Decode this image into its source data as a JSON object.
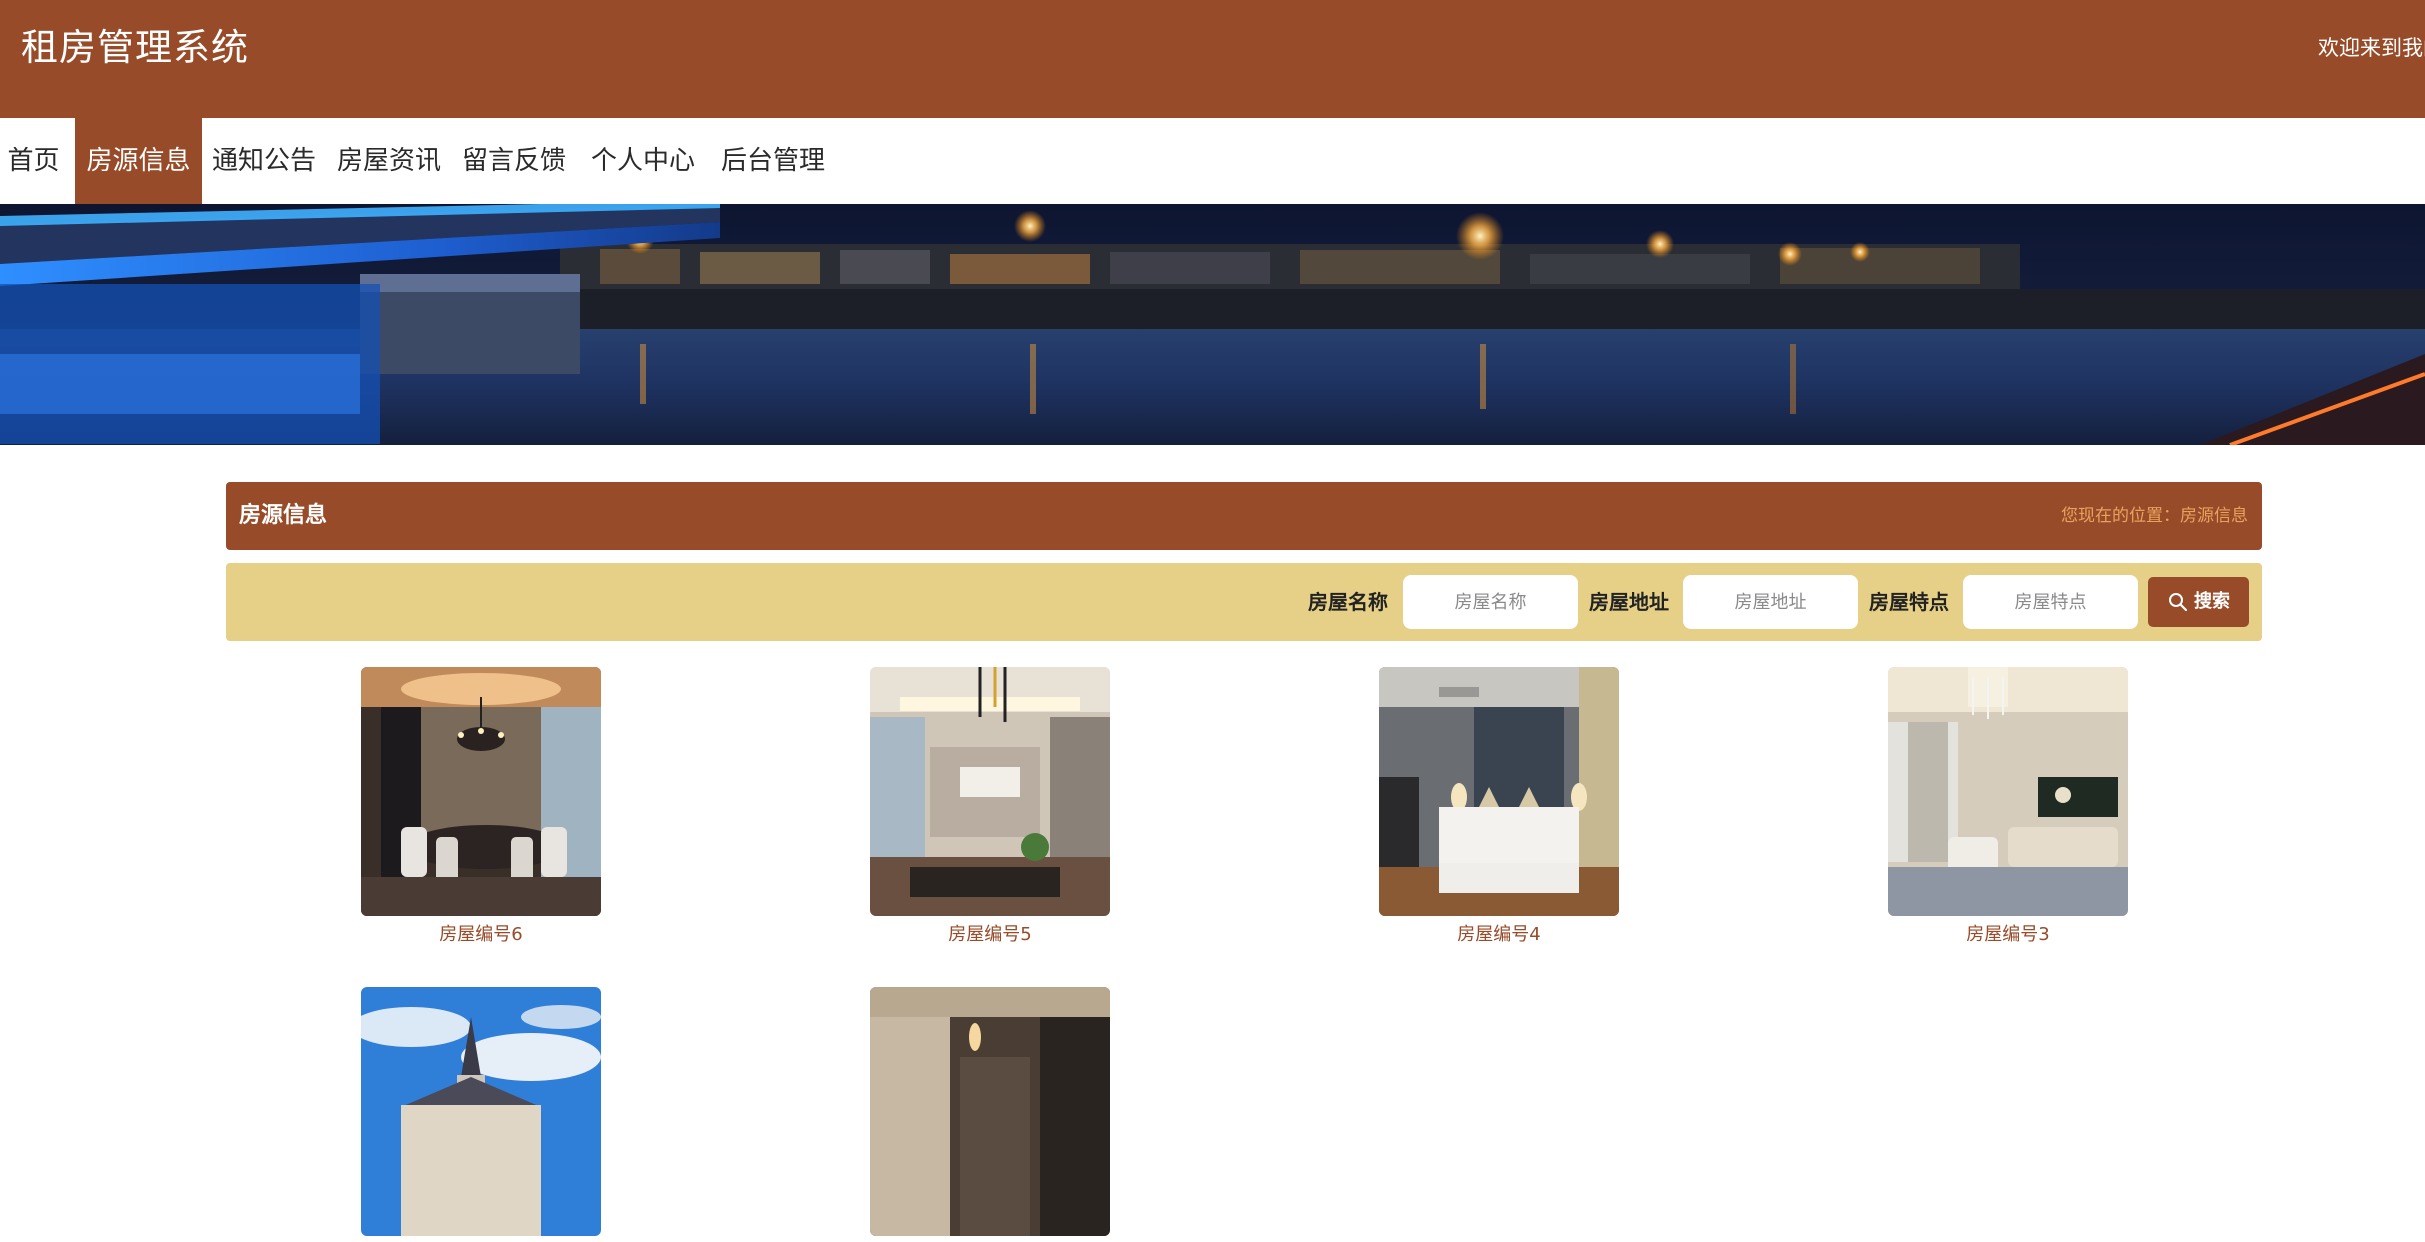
{
  "header": {
    "title": "租房管理系统",
    "welcome": "欢迎来到我的"
  },
  "nav": {
    "items": [
      {
        "label": "首页",
        "active": false
      },
      {
        "label": "房源信息",
        "active": true
      },
      {
        "label": "通知公告",
        "active": false
      },
      {
        "label": "房屋资讯",
        "active": false
      },
      {
        "label": "留言反馈",
        "active": false
      },
      {
        "label": "个人中心",
        "active": false
      },
      {
        "label": "后台管理",
        "active": false
      }
    ]
  },
  "banner": {
    "slide_count": 3,
    "active_slide": 1
  },
  "section": {
    "title": "房源信息",
    "breadcrumb": "您现在的位置：房源信息"
  },
  "search": {
    "name_label": "房屋名称",
    "name_placeholder": "房屋名称",
    "address_label": "房屋地址",
    "address_placeholder": "房屋地址",
    "feature_label": "房屋特点",
    "feature_placeholder": "房屋特点",
    "button_label": "搜索",
    "button_icon": "search-icon"
  },
  "houses": [
    {
      "name": "房屋编号6"
    },
    {
      "name": "房屋编号5"
    },
    {
      "name": "房屋编号4"
    },
    {
      "name": "房屋编号3"
    },
    {
      "name": ""
    },
    {
      "name": ""
    }
  ],
  "colors": {
    "brand": "#974b29",
    "search_bar": "#e6cf86",
    "breadcrumb": "#eaa35d",
    "link": "#974b29"
  }
}
